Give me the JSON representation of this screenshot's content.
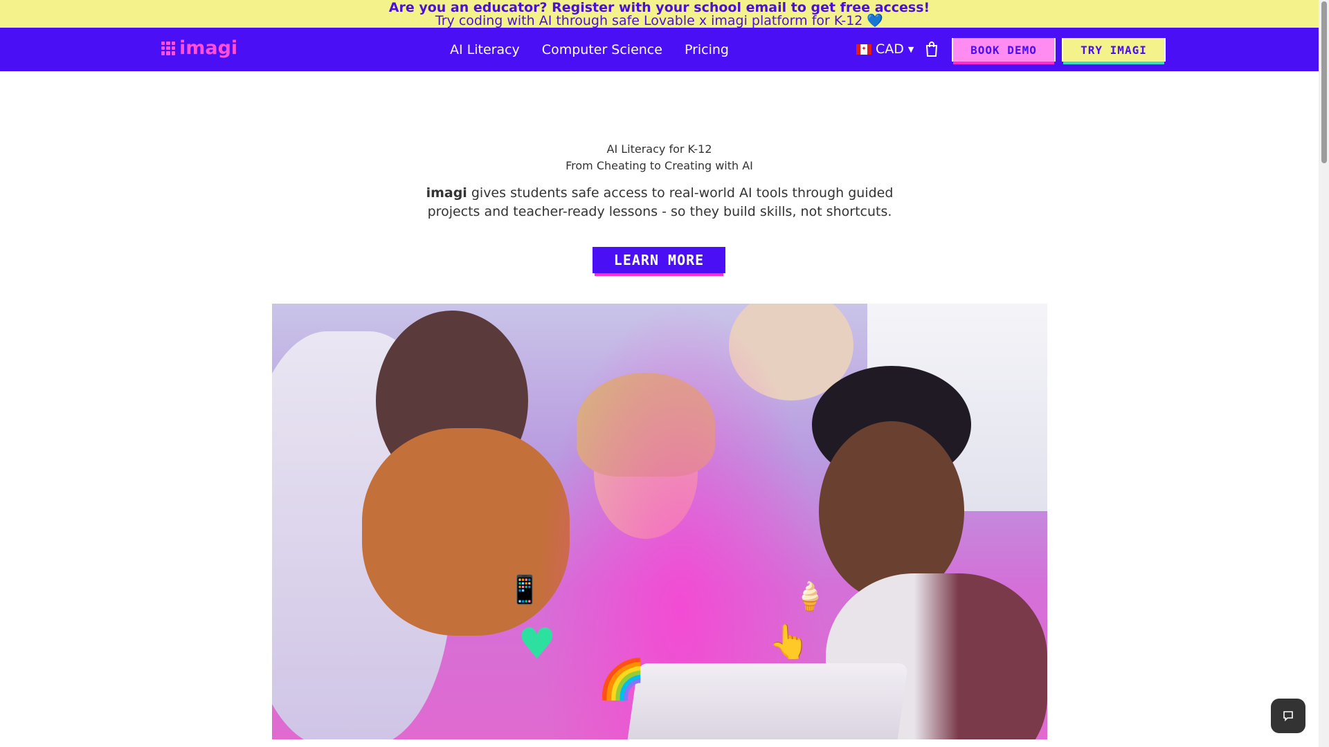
{
  "promo": {
    "line1": "Are you an educator? Register with your school email to get free access!",
    "line2": "Try coding with AI through safe Lovable x imagi platform for K-12",
    "heart": "💙"
  },
  "nav": {
    "logo": "imagi",
    "links": [
      "AI Literacy",
      "Computer Science",
      "Pricing"
    ],
    "currency": "CAD",
    "book_demo": "BOOK DEMO",
    "try_imagi": "TRY IMAGI"
  },
  "hero": {
    "eyebrow": "AI Literacy for K-12",
    "subtitle": "From Cheating to Creating with AI",
    "desc_brand": "imagi",
    "desc_rest": " gives students safe access to real-world AI tools through guided projects and teacher-ready lessons - so they build skills, not shortcuts.",
    "cta": "LEARN MORE"
  },
  "colors": {
    "brand": "#4a0ff5",
    "pink": "#ff4fd8",
    "yellow": "#f4f28a"
  }
}
